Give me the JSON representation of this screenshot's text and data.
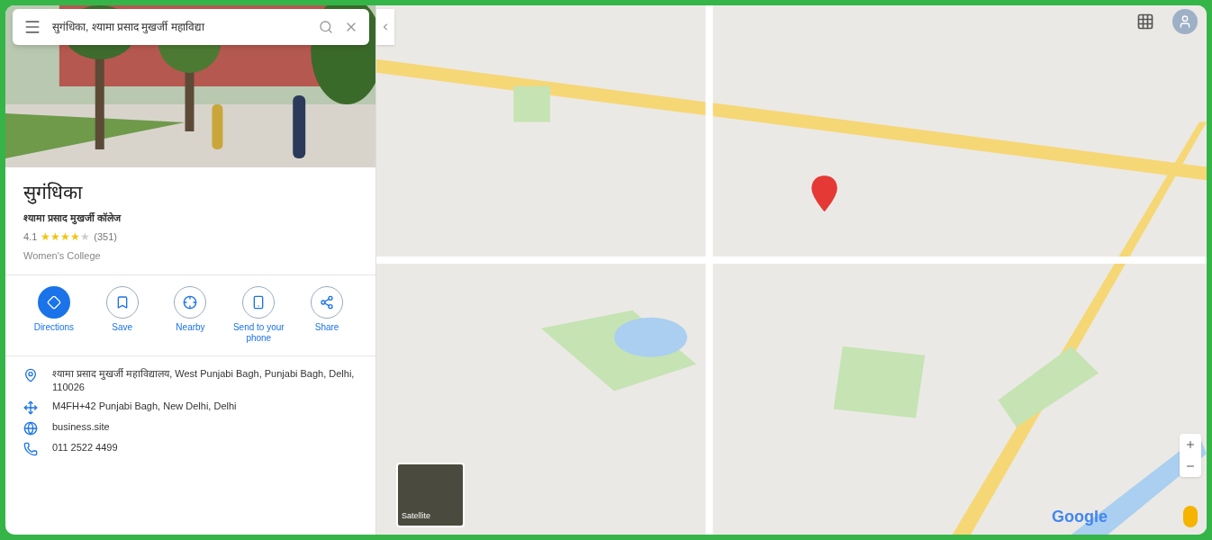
{
  "search": {
    "value": "सुगंधिका, श्यामा प्रसाद मुखर्जी महाविद्या"
  },
  "place": {
    "title": "सुगंधिका",
    "subtitle": "श्यामा प्रसाद मुखर्जी कॉलेज",
    "rating": "4.1",
    "stars": 4,
    "reviews": "(351)",
    "category": "Women's College"
  },
  "actions": [
    {
      "kind": "directions",
      "label": "Directions",
      "primary": true
    },
    {
      "kind": "save",
      "label": "Save",
      "primary": false
    },
    {
      "kind": "nearby",
      "label": "Nearby",
      "primary": false
    },
    {
      "kind": "phone",
      "label": "Send to your phone",
      "primary": false
    },
    {
      "kind": "share",
      "label": "Share",
      "primary": false
    }
  ],
  "info": [
    {
      "kind": "address",
      "text": "श्यामा प्रसाद मुखर्जी महाविद्यालय, West Punjabi Bagh, Punjabi Bagh, Delhi, 110026"
    },
    {
      "kind": "pluscode",
      "text": "M4FH+42 Punjabi Bagh, New Delhi, Delhi"
    },
    {
      "kind": "website",
      "text": "business.site"
    },
    {
      "kind": "phone",
      "text": "011 2522 4499"
    }
  ],
  "map": {
    "layer_toggle": "Satellite",
    "logo": "Google"
  }
}
